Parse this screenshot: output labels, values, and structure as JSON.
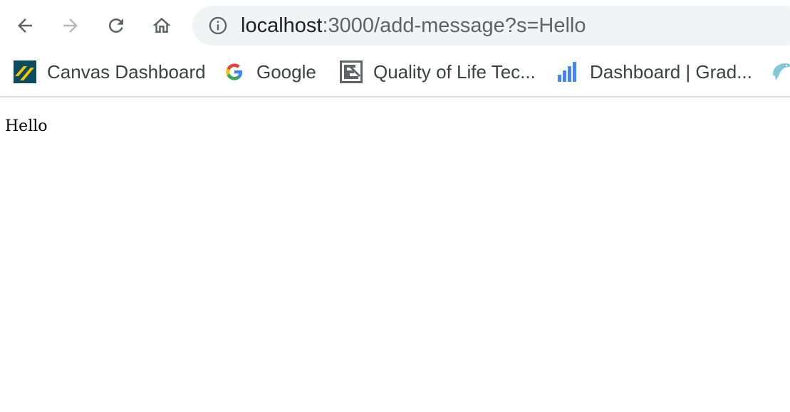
{
  "toolbar": {
    "back_icon": "arrow-left-icon",
    "forward_icon": "arrow-right-icon",
    "reload_icon": "reload-icon",
    "home_icon": "home-icon",
    "info_icon": "info-icon"
  },
  "address_bar": {
    "host": "localhost",
    "path": ":3000/add-message?s=Hello"
  },
  "bookmarks": [
    {
      "label": "Canvas Dashboard",
      "icon": "canvas-icon"
    },
    {
      "label": "Google",
      "icon": "google-icon"
    },
    {
      "label": "Quality of Life Tec...",
      "icon": "qol-icon"
    },
    {
      "label": "Dashboard | Grad...",
      "icon": "bar-chart-icon"
    },
    {
      "label": "",
      "icon": "dolphin-icon"
    }
  ],
  "page": {
    "text": "Hello"
  },
  "colors": {
    "omnibox_bg": "#f1f3f4",
    "icon_gray": "#5f6368",
    "disabled_gray": "#b7b9bc",
    "accent_blue": "#4285f4"
  }
}
